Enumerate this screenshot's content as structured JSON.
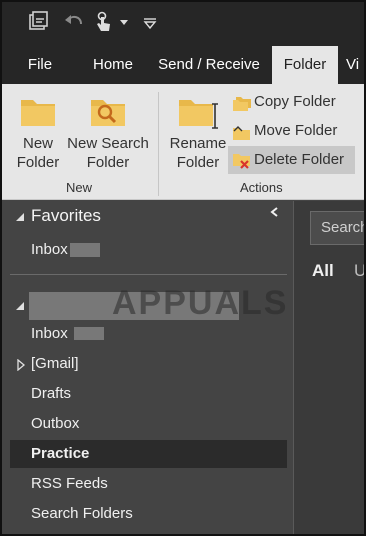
{
  "tabs": [
    {
      "label": "File"
    },
    {
      "label": "Home"
    },
    {
      "label": "Send / Receive"
    },
    {
      "label": "Folder"
    },
    {
      "label": "Vi"
    }
  ],
  "ribbon": {
    "new_group": {
      "new_folder": [
        "New",
        "Folder"
      ],
      "new_search_folder": [
        "New Search",
        "Folder"
      ],
      "label": "New"
    },
    "actions_group": {
      "rename_folder": [
        "Rename",
        "Folder"
      ],
      "copy_folder": "Copy Folder",
      "move_folder": "Move Folder",
      "delete_folder": "Delete Folder",
      "label": "Actions"
    }
  },
  "folder_pane": {
    "favorites_label": "Favorites",
    "favorites": [
      {
        "label": "Inbox"
      }
    ],
    "account_folders": [
      {
        "label": "Inbox"
      },
      {
        "label": "[Gmail]"
      },
      {
        "label": "Drafts"
      },
      {
        "label": "Outbox"
      },
      {
        "label": "Practice"
      },
      {
        "label": "RSS Feeds"
      },
      {
        "label": "Search Folders"
      }
    ],
    "selected": "Practice"
  },
  "main": {
    "search_placeholder": "Search",
    "filter_all": "All",
    "filter_unread": "U"
  },
  "watermark": "APPUALS",
  "colors": {
    "accent_red": "#d9342b",
    "folder_yellow": "#e8b84a",
    "dark_bg": "#262626",
    "pane_bg": "#444444",
    "ribbon_bg": "#e6e6e6"
  }
}
